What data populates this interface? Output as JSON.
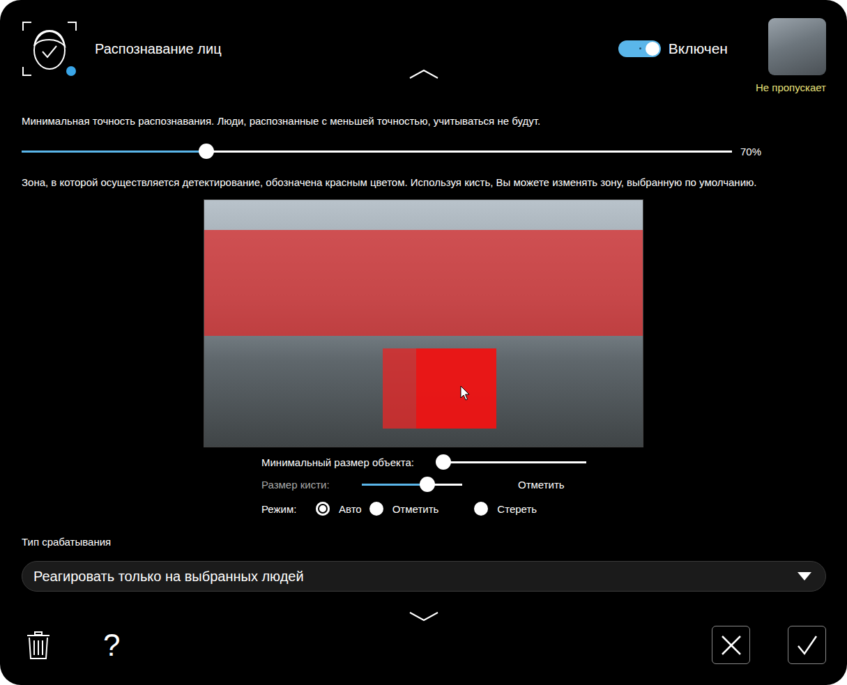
{
  "header": {
    "title": "Распознавание лиц",
    "toggle": {
      "label": "Включен",
      "on": true
    },
    "camera": {
      "status": "Не пропускает"
    }
  },
  "accuracy": {
    "description": "Минимальная точность распознавания. Люди, распознанные с меньшей точностью, учитываться не будут.",
    "level": 0.26,
    "reading": "70%"
  },
  "zone": {
    "description": "Зона, в которой осуществляется детектирование, обозначена красным цветом. Используя кисть, Вы можете изменять зону, выбранную по умолчанию."
  },
  "min_size": {
    "label": "Минимальный размер объекта:",
    "level": 0
  },
  "brush": {
    "label": "Размер кисти:",
    "level": 0.65,
    "disabled": true,
    "action": "Отметить"
  },
  "mode": {
    "label": "Режим:",
    "options": [
      {
        "label": "Авто",
        "selected": true
      },
      {
        "label": "Отметить",
        "selected": false
      },
      {
        "label": "Стереть",
        "selected": false
      }
    ]
  },
  "trigger": {
    "label": "Тип срабатывания",
    "value": "Реагировать только на выбранных людей"
  },
  "help": "?"
}
